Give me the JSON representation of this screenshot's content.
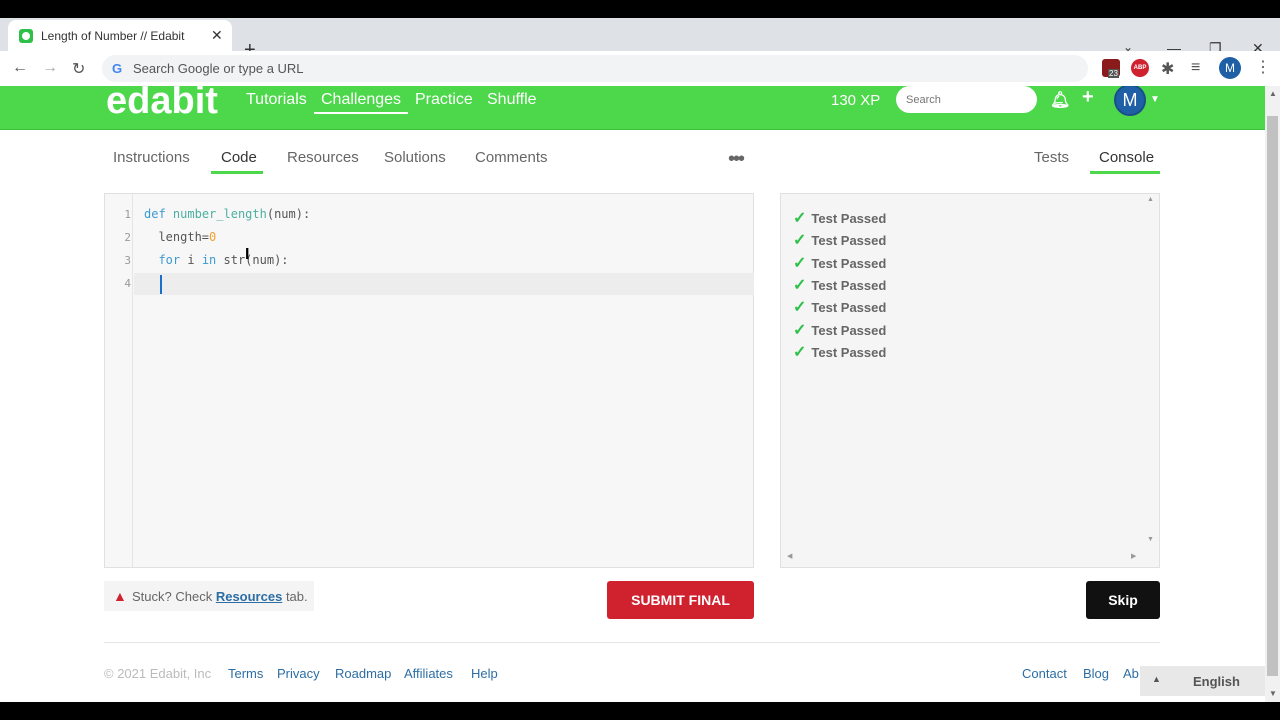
{
  "browser": {
    "tab_title": "Length of Number // Edabit",
    "omnibox_placeholder": "Search Google or type a URL",
    "extension_badge": "23",
    "abp_label": "ABP",
    "profile_initial": "M"
  },
  "header": {
    "logo": "edabit",
    "nav": [
      "Tutorials",
      "Challenges",
      "Practice",
      "Shuffle"
    ],
    "active_nav": "Challenges",
    "xp": "130 XP",
    "search_placeholder": "Search",
    "avatar_initial": "M"
  },
  "subtabs": {
    "left": [
      "Instructions",
      "Code",
      "Resources",
      "Solutions",
      "Comments"
    ],
    "active_left": "Code",
    "more": "•••",
    "right": [
      "Tests",
      "Console"
    ],
    "active_right": "Console"
  },
  "editor": {
    "line_numbers": [
      "1",
      "2",
      "3",
      "4"
    ],
    "lines": [
      "def number_length(num):",
      "  length=0",
      "  for i in str(num):",
      "  "
    ]
  },
  "console": {
    "results": [
      "Test Passed",
      "Test Passed",
      "Test Passed",
      "Test Passed",
      "Test Passed",
      "Test Passed",
      "Test Passed"
    ]
  },
  "actions": {
    "stuck_prefix": "Stuck? Check",
    "stuck_link": "Resources",
    "stuck_suffix": "tab.",
    "submit": "SUBMIT FINAL",
    "skip": "Skip"
  },
  "footer": {
    "copyright": "© 2021 Edabit, Inc",
    "links": [
      "Terms",
      "Privacy",
      "Roadmap",
      "Affiliates",
      "Help"
    ],
    "right_links": [
      "Contact",
      "Blog",
      "Ab"
    ],
    "language": "English"
  },
  "colors": {
    "brand_green": "#4dd74a",
    "submit_red": "#d0212f",
    "link_blue": "#2c6ea4"
  }
}
